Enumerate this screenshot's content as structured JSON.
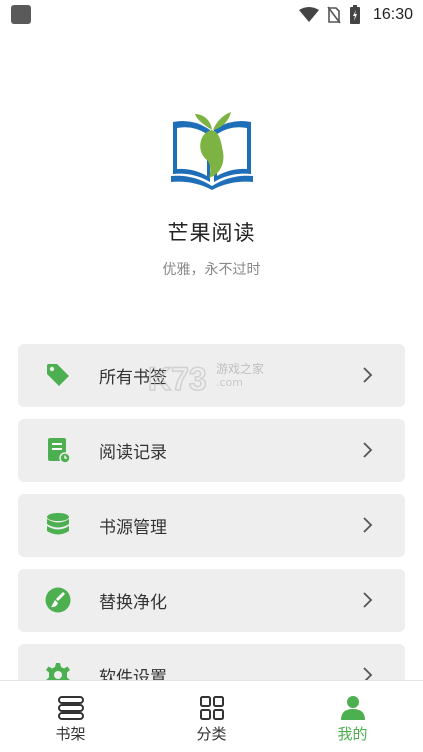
{
  "status_bar": {
    "time": "16:30"
  },
  "app": {
    "name": "芒果阅读",
    "slogan": "优雅，永不过时"
  },
  "menu": [
    {
      "label": "所有书签",
      "icon": "tag-icon"
    },
    {
      "label": "阅读记录",
      "icon": "reading-record-icon"
    },
    {
      "label": "书源管理",
      "icon": "database-icon"
    },
    {
      "label": "替换净化",
      "icon": "brush-icon"
    },
    {
      "label": "软件设置",
      "icon": "gear-icon"
    }
  ],
  "watermark": {
    "text": "游戏之家",
    "sub": ".com"
  },
  "bottom_nav": [
    {
      "label": "书架",
      "icon": "bookshelf-icon",
      "active": false
    },
    {
      "label": "分类",
      "icon": "grid-icon",
      "active": false
    },
    {
      "label": "我的",
      "icon": "person-icon",
      "active": true
    }
  ],
  "colors": {
    "accent": "#4caf50",
    "card_bg": "#eeeeee",
    "logo_blue": "#1f6fb8"
  }
}
